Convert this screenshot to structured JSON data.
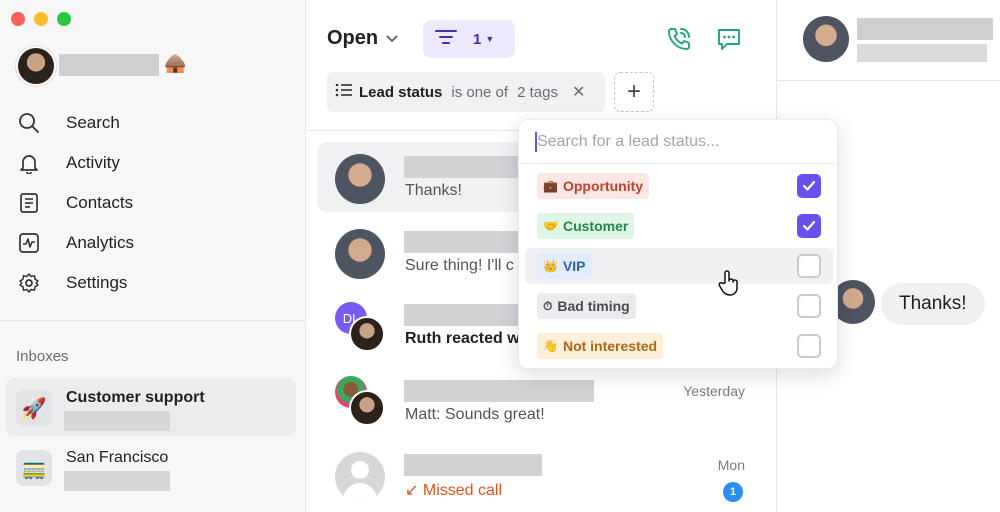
{
  "window": {
    "traffic_colors": [
      "#ff5f57",
      "#febc2e",
      "#28c840"
    ]
  },
  "user": {
    "status_emoji": "🛖"
  },
  "nav": {
    "items": [
      {
        "label": "Search",
        "icon": "search-icon"
      },
      {
        "label": "Activity",
        "icon": "bell-icon"
      },
      {
        "label": "Contacts",
        "icon": "contacts-icon"
      },
      {
        "label": "Analytics",
        "icon": "analytics-icon"
      },
      {
        "label": "Settings",
        "icon": "gear-icon"
      }
    ]
  },
  "inboxes": {
    "label": "Inboxes",
    "items": [
      {
        "title": "Customer support",
        "emoji": "🚀",
        "active": true
      },
      {
        "title": "San Francisco",
        "emoji": "🚃",
        "active": false
      }
    ]
  },
  "header": {
    "status_filter": "Open",
    "filter_count": "1",
    "accent": "#1fa774"
  },
  "filter_chip": {
    "field": "Lead status",
    "operator": "is one of",
    "value": "2 tags"
  },
  "conversations": [
    {
      "preview": "Thanks!",
      "time": "",
      "active": true
    },
    {
      "preview": "Sure thing! I'll c",
      "time": ""
    },
    {
      "preview": "Ruth reacted w",
      "time": "",
      "avatar_initials": "DL"
    },
    {
      "preview": "Matt: Sounds great!",
      "time": "Yesterday"
    },
    {
      "preview": "Missed call",
      "time": "Mon",
      "unread": "1"
    }
  ],
  "lead_status_dropdown": {
    "placeholder": "Search for a lead status...",
    "options": [
      {
        "label": "Opportunity",
        "emoji": "💼",
        "checked": true,
        "bg": "#fde7e4",
        "fg": "#c2412d"
      },
      {
        "label": "Customer",
        "emoji": "🤝",
        "checked": true,
        "bg": "#dff5e6",
        "fg": "#1f8a47"
      },
      {
        "label": "VIP",
        "emoji": "👑",
        "checked": false,
        "bg": "#e3ecfb",
        "fg": "#2f5fb3"
      },
      {
        "label": "Bad timing",
        "emoji": "⏱",
        "checked": false,
        "bg": "#ebebee",
        "fg": "#4a4a52"
      },
      {
        "label": "Not interested",
        "emoji": "👋",
        "checked": false,
        "bg": "#fdf0d9",
        "fg": "#b0651a"
      }
    ]
  },
  "detail": {
    "message": "Thanks!"
  }
}
